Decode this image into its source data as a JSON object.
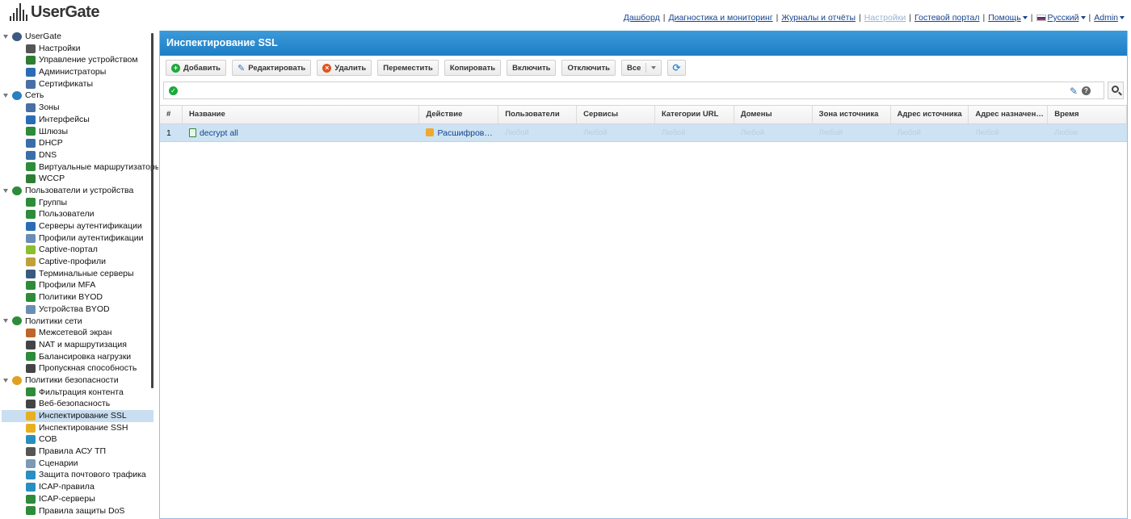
{
  "brand": {
    "name": "UserGate"
  },
  "topnav": [
    {
      "label": "Дашборд",
      "disabled": false,
      "dropdown": false
    },
    {
      "label": "Диагностика и мониторинг",
      "disabled": false,
      "dropdown": false
    },
    {
      "label": "Журналы и отчёты",
      "disabled": false,
      "dropdown": false
    },
    {
      "label": "Настройки",
      "disabled": true,
      "dropdown": false
    },
    {
      "label": "Гостевой портал",
      "disabled": false,
      "dropdown": false
    },
    {
      "label": "Помощь",
      "disabled": false,
      "dropdown": true
    },
    {
      "label": "Русский",
      "disabled": false,
      "dropdown": true,
      "flag": true
    },
    {
      "label": "Admin",
      "disabled": false,
      "dropdown": true
    }
  ],
  "sidebar": {
    "groups": [
      {
        "label": "UserGate",
        "icon": "usergate-icon",
        "color": "#3d5a80",
        "items": [
          {
            "label": "Настройки",
            "icon": "gear-icon",
            "color": "#555555"
          },
          {
            "label": "Управление устройством",
            "icon": "device-icon",
            "color": "#2e7d32"
          },
          {
            "label": "Администраторы",
            "icon": "admins-icon",
            "color": "#2a6db5"
          },
          {
            "label": "Сертификаты",
            "icon": "certificate-icon",
            "color": "#4a6fa5"
          }
        ]
      },
      {
        "label": "Сеть",
        "icon": "network-icon",
        "color": "#2a7fc0",
        "items": [
          {
            "label": "Зоны",
            "icon": "zones-icon",
            "color": "#4a6fa5"
          },
          {
            "label": "Интерфейсы",
            "icon": "interfaces-icon",
            "color": "#2a6db5"
          },
          {
            "label": "Шлюзы",
            "icon": "gateway-icon",
            "color": "#2e8b3a"
          },
          {
            "label": "DHCP",
            "icon": "dhcp-icon",
            "color": "#3a6ea8"
          },
          {
            "label": "DNS",
            "icon": "dns-icon",
            "color": "#3a6ea8"
          },
          {
            "label": "Виртуальные маршрутизаторы",
            "icon": "router-icon",
            "color": "#2e8b3a"
          },
          {
            "label": "WCCP",
            "icon": "wccp-icon",
            "color": "#2e7d32"
          }
        ]
      },
      {
        "label": "Пользователи и устройства",
        "icon": "users-devices-icon",
        "color": "#2e8b3a",
        "items": [
          {
            "label": "Группы",
            "icon": "groups-icon",
            "color": "#2e8b3a"
          },
          {
            "label": "Пользователи",
            "icon": "user-icon",
            "color": "#2e8b3a"
          },
          {
            "label": "Серверы аутентификации",
            "icon": "auth-server-icon",
            "color": "#2a6db5"
          },
          {
            "label": "Профили аутентификации",
            "icon": "auth-profile-icon",
            "color": "#6a8db5"
          },
          {
            "label": "Captive-портал",
            "icon": "captive-portal-icon",
            "color": "#8bbf2f"
          },
          {
            "label": "Captive-профили",
            "icon": "captive-profile-icon",
            "color": "#c0a03a"
          },
          {
            "label": "Терминальные серверы",
            "icon": "terminal-server-icon",
            "color": "#3a5a80"
          },
          {
            "label": "Профили MFA",
            "icon": "mfa-icon",
            "color": "#2e8b3a"
          },
          {
            "label": "Политики BYOD",
            "icon": "byod-policy-icon",
            "color": "#2e8b3a"
          },
          {
            "label": "Устройства BYOD",
            "icon": "byod-device-icon",
            "color": "#6a8db5"
          }
        ]
      },
      {
        "label": "Политики сети",
        "icon": "network-policies-icon",
        "color": "#2e8b3a",
        "items": [
          {
            "label": "Межсетевой экран",
            "icon": "firewall-icon",
            "color": "#c0652a"
          },
          {
            "label": "NAT и маршрутизация",
            "icon": "nat-icon",
            "color": "#444444"
          },
          {
            "label": "Балансировка нагрузки",
            "icon": "balancing-icon",
            "color": "#2e8b3a"
          },
          {
            "label": "Пропускная способность",
            "icon": "bandwidth-icon",
            "color": "#444444"
          }
        ]
      },
      {
        "label": "Политики безопасности",
        "icon": "security-policies-icon",
        "color": "#e0a020",
        "items": [
          {
            "label": "Фильтрация контента",
            "icon": "content-filter-icon",
            "color": "#2e8b3a"
          },
          {
            "label": "Веб-безопасность",
            "icon": "web-security-icon",
            "color": "#444444"
          },
          {
            "label": "Инспектирование SSL",
            "icon": "ssl-inspection-icon",
            "color": "#e8b020",
            "selected": true
          },
          {
            "label": "Инспектирование SSH",
            "icon": "ssh-inspection-icon",
            "color": "#e8b020"
          },
          {
            "label": "СОВ",
            "icon": "ids-icon",
            "color": "#2a8fc0"
          },
          {
            "label": "Правила АСУ ТП",
            "icon": "scada-rules-icon",
            "color": "#555555"
          },
          {
            "label": "Сценарии",
            "icon": "scenarios-icon",
            "color": "#7a9ab5"
          },
          {
            "label": "Защита почтового трафика",
            "icon": "mail-protection-icon",
            "color": "#2a8fc0"
          },
          {
            "label": "ICAP-правила",
            "icon": "icap-rules-icon",
            "color": "#2a8fc0"
          },
          {
            "label": "ICAP-серверы",
            "icon": "icap-servers-icon",
            "color": "#2e8b3a"
          },
          {
            "label": "Правила защиты DoS",
            "icon": "dos-protection-icon",
            "color": "#2e8b3a"
          }
        ]
      }
    ]
  },
  "panel": {
    "title": "Инспектирование SSL"
  },
  "toolbar": {
    "add_label": "Добавить",
    "edit_label": "Редактировать",
    "delete_label": "Удалить",
    "move_label": "Переместить",
    "copy_label": "Копировать",
    "enable_label": "Включить",
    "disable_label": "Отключить",
    "filter_label": "Все"
  },
  "table": {
    "columns": [
      "#",
      "Название",
      "Действие",
      "Пользователи",
      "Сервисы",
      "Категории URL",
      "Домены",
      "Зона источника",
      "Адрес источника",
      "Адрес назначен…",
      "Время"
    ],
    "rows": [
      {
        "num": "1",
        "name": "decrypt all",
        "action": "Расшифров…",
        "users": "Любой",
        "services": "Любой",
        "url_categories": "Любой",
        "domains": "Любой",
        "src_zone": "Любой",
        "src_address": "Любой",
        "dst_address": "Любой",
        "time": "Любое"
      }
    ]
  },
  "colors": {
    "accent": "#1d7ec6",
    "selection": "#cde3f3",
    "link": "#15428b"
  }
}
